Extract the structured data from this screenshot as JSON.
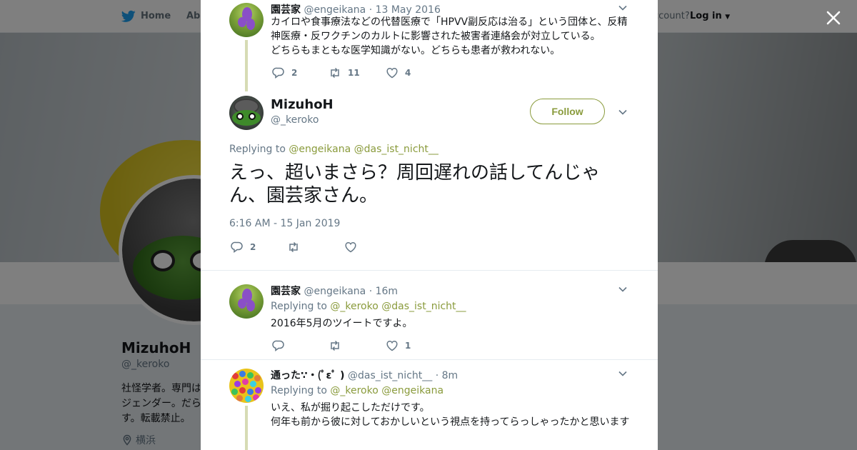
{
  "nav": {
    "home": "Home",
    "about": "Abo",
    "account_prompt": "ccount?",
    "login": "Log in"
  },
  "profile": {
    "name": "MizuhoH",
    "handle": "@_keroko",
    "bio": "社怪学者。専門はジェンダー。だらす。転載禁止。",
    "bio_lines": [
      "社怪学者。専門は",
      "ジェンダー。だら",
      "す。転載禁止。"
    ],
    "location": "横浜"
  },
  "tweets": {
    "parent": {
      "name": "園芸家",
      "handle": "@engeikana",
      "time": "· 13 May 2016",
      "text": "カイロや食事療法などの代替医療で「HPVV副反応は治る」という団体と、反精神医療・反ワクチンのカルトに影響された被害者連絡会が対立している。\nどちらもまともな医学知識がない。どちらも患者が救われない。",
      "replies": "2",
      "retweets": "11",
      "likes": "4"
    },
    "main": {
      "name": "MizuhoH",
      "handle": "@_keroko",
      "follow_label": "Follow",
      "replying_label": "Replying to",
      "reply_targets": [
        "@engeikana",
        "@das_ist_nicht__"
      ],
      "text": "えっ、超いまさら？周回遅れの話してんじゃん、園芸家さん。",
      "timestamp": "6:16 AM - 15 Jan 2019",
      "replies": "2",
      "retweets": "",
      "likes": ""
    },
    "reply1": {
      "name": "園芸家",
      "handle": "@engeikana",
      "time": "· 16m",
      "replying_label": "Replying to",
      "reply_targets": [
        "@_keroko",
        "@das_ist_nicht__"
      ],
      "text": "2016年5月のツイートですよ。",
      "replies": "",
      "retweets": "",
      "likes": "1"
    },
    "reply2": {
      "name": "通った∵・(ﾟεﾟ )",
      "handle": "@das_ist_nicht__",
      "time": "· 8m",
      "replying_label": "Replying to",
      "reply_targets": [
        "@_keroko",
        "@engeikana"
      ],
      "text": "いえ、私が掘り起こしただけです。\n何年も前から彼に対しておかしいという視点を持ってらっしゃったかと思います"
    }
  },
  "icons": {
    "brand": "twitter-bird-icon",
    "close": "close-icon",
    "reply": "reply-icon",
    "retweet": "retweet-icon",
    "like": "heart-icon",
    "menu": "chevron-down-icon",
    "location": "location-pin-icon"
  },
  "colors": {
    "link": "#8a9b3c",
    "brand": "#1da1f2",
    "muted": "#657786",
    "overlay": "rgba(0,0,0,0.5)"
  }
}
